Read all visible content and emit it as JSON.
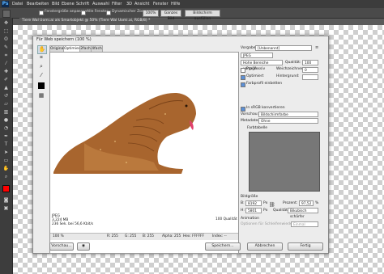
{
  "app": {
    "logo": "Ps"
  },
  "menu": [
    "Datei",
    "Bearbeiten",
    "Bild",
    "Ebene",
    "Schrift",
    "Auswahl",
    "Filter",
    "3D",
    "Ansicht",
    "Fenster",
    "Hilfe"
  ],
  "options": {
    "resize_windows": "Fenstergröße anpassen",
    "all_windows": "Alle Fenster",
    "dynamic_zoom": "Dynamischer Zoom",
    "zoom_value": "100%",
    "fit_screen_button": "Ganzes Bild",
    "fill_screen_button": "Bildschirm ausfüllen"
  },
  "document_tab": {
    "title": "Tiere Wal Uomi.ai als Smartobjekt @ 50% (Tiere Wal Uomi.ai, RGB/8) *"
  },
  "dialog": {
    "title": "Für Web speichern (100 %)",
    "tabs": [
      "Original",
      "Optimiert",
      "2fach",
      "4fach"
    ],
    "preview_info": [
      "JPEG",
      "3,224 MB",
      "236 Sek. bei 56,6 Kbit/s"
    ],
    "preview_right": "100 Qualität",
    "status": {
      "zoom": "100 %",
      "r": "R: 255",
      "g": "G: 255",
      "b": "B: 255",
      "alpha": "Alpha: 255",
      "hex": "Hex: FFFFFF",
      "index": "Index: --"
    },
    "buttons": {
      "preview": "Vorschau...",
      "save": "Speichern...",
      "cancel": "Abbrechen",
      "done": "Fertig"
    },
    "settings": {
      "preset_label": "Vorgabe:",
      "preset_value": "[Unbenannt]",
      "format_value": "JPEG",
      "quality_mode": "Hohe Bereiche vergröß...",
      "quality_label": "Qualität:",
      "quality_value": "100",
      "progressive": "Progressiv",
      "blur_label": "Weichzeichnen:",
      "blur_value": "0",
      "optimized": "Optimiert",
      "matte_label": "Hintergrund:",
      "embed_profile": "Farbprofil einbetten",
      "convert_srgb": "In sRGB konvertieren",
      "preview_label": "Vorschau:",
      "preview_value": "Bildschirmfarbe",
      "metadata_label": "Metadaten:",
      "metadata_value": "Ohne",
      "color_table_label": "Farbtabelle",
      "image_size_label": "Bildgröße",
      "width_label": "B:",
      "width_value": "8192",
      "width_unit": "Px",
      "height_label": "H:",
      "height_value": "5801",
      "height_unit": "Px",
      "percent_label": "Prozent:",
      "percent_value": "97,52",
      "percent_unit": "%",
      "quality2_label": "Qualität:",
      "quality2_value": "Bikubisch schärfer",
      "animation_label": "Animation",
      "loop_label": "Optionen für Schleifenwiedergabe:",
      "loop_value": "Einmal"
    }
  },
  "colors": {
    "walrus": "#a8652e",
    "canvas_dark": "#5a5a5a"
  }
}
